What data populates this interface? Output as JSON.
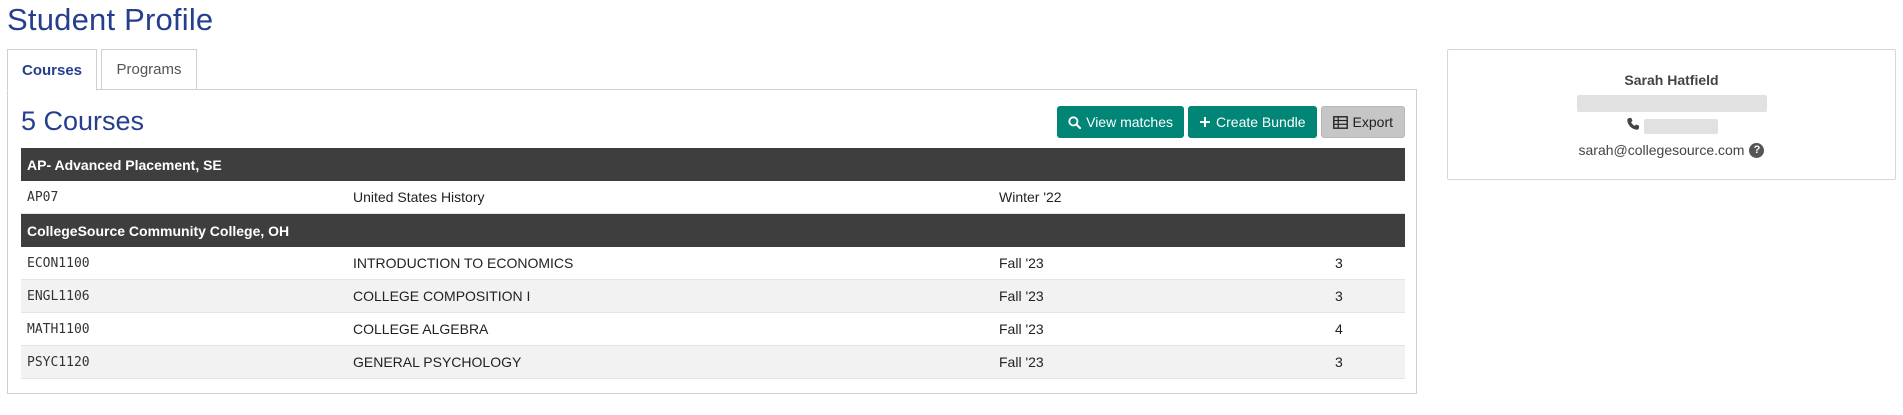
{
  "page": {
    "title": "Student Profile"
  },
  "tabs": [
    {
      "label": "Courses",
      "active": true
    },
    {
      "label": "Programs",
      "active": false
    }
  ],
  "courses": {
    "heading": "5 Courses",
    "buttons": {
      "view_matches": "View matches",
      "create_bundle": "Create Bundle",
      "export": "Export"
    },
    "groups": [
      {
        "institution": "AP- Advanced Placement, SE",
        "rows": [
          {
            "code": "AP07",
            "title": "United States History",
            "term": "Winter '22",
            "credits": ""
          }
        ]
      },
      {
        "institution": "CollegeSource Community College, OH",
        "rows": [
          {
            "code": "ECON1100",
            "title": "INTRODUCTION TO ECONOMICS",
            "term": "Fall '23",
            "credits": "3"
          },
          {
            "code": "ENGL1106",
            "title": "COLLEGE COMPOSITION I",
            "term": "Fall '23",
            "credits": "3"
          },
          {
            "code": "MATH1100",
            "title": "COLLEGE ALGEBRA",
            "term": "Fall '23",
            "credits": "4"
          },
          {
            "code": "PSYC1120",
            "title": "GENERAL PSYCHOLOGY",
            "term": "Fall '23",
            "credits": "3"
          }
        ]
      }
    ]
  },
  "student": {
    "name": "Sarah Hatfield",
    "email": "sarah@collegesource.com",
    "help_glyph": "?"
  },
  "icons": {
    "view_matches": "search-icon",
    "create_bundle": "plus-icon",
    "export": "table-icon",
    "phone": "phone-icon",
    "help": "question-circle-icon"
  },
  "colors": {
    "primary_text": "#253f8e",
    "accent": "#008577",
    "group_header": "#3e3e3e"
  }
}
